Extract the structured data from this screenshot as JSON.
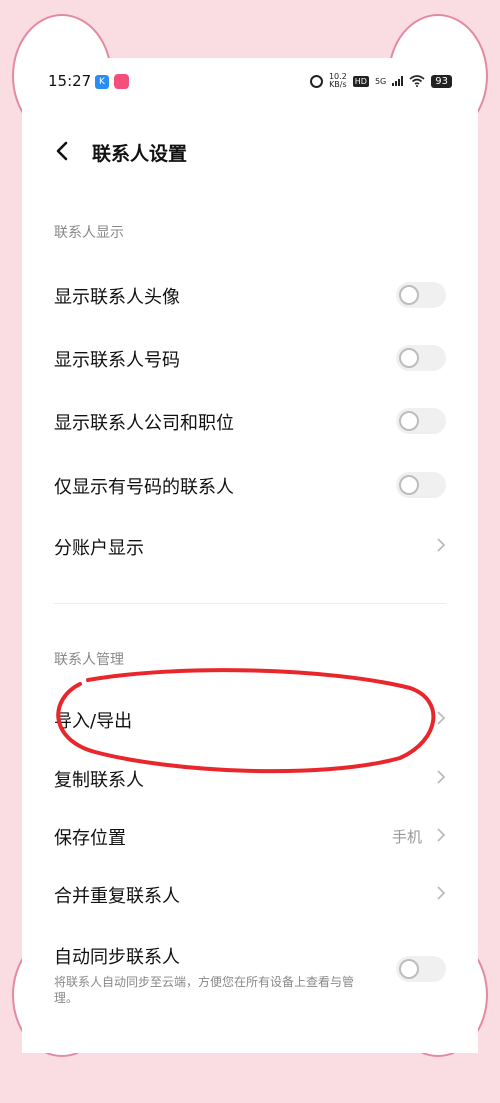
{
  "status_bar": {
    "time": "15:27",
    "k_icon": "K",
    "net_speed_value": "10.2",
    "net_speed_unit": "KB/s",
    "hd": "HD",
    "signal": "5G",
    "battery": "93"
  },
  "header": {
    "title": "联系人设置"
  },
  "display_section": {
    "header": "联系人显示",
    "items": [
      {
        "label": "显示联系人头像",
        "on": false
      },
      {
        "label": "显示联系人号码",
        "on": false
      },
      {
        "label": "显示联系人公司和职位",
        "on": false
      },
      {
        "label": "仅显示有号码的联系人",
        "on": false
      }
    ],
    "account_display": "分账户显示"
  },
  "manage_section": {
    "header": "联系人管理",
    "import_export": "导入/导出",
    "copy": "复制联系人",
    "save_location": {
      "label": "保存位置",
      "value": "手机"
    },
    "merge": "合并重复联系人",
    "auto_sync": {
      "label": "自动同步联系人",
      "description": "将联系人自动同步至云端，方便您在所有设备上查看与管理。",
      "on": false
    }
  },
  "annotation_color": "#e8262c",
  "colors": {
    "background_pink": "#f9dde3",
    "ear_outline": "#e48aa0"
  }
}
